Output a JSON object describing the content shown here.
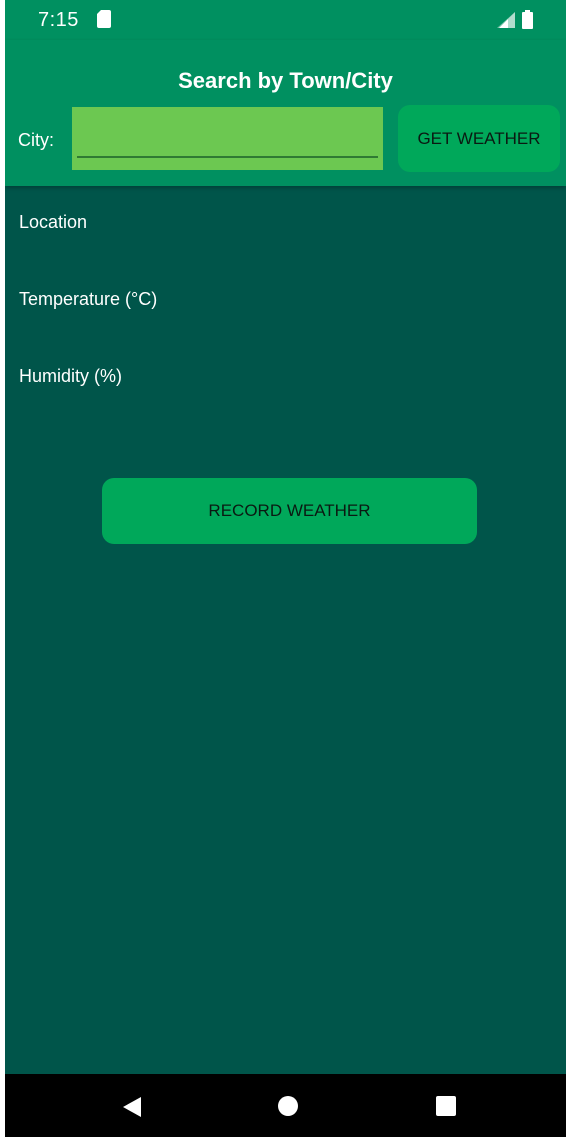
{
  "status_bar": {
    "time": "7:15",
    "icons": [
      "sd-card-icon",
      "signal-icon",
      "battery-icon"
    ]
  },
  "header": {
    "title": "Search by Town/City",
    "city_label": "City:",
    "city_input": {
      "value": "",
      "placeholder": ""
    },
    "get_weather_label": "GET WEATHER"
  },
  "results": {
    "location_label": "Location",
    "temperature_label": "Temperature (°C)",
    "humidity_label": "Humidity (%)"
  },
  "record_weather_label": "RECORD WEATHER",
  "nav_bar": {
    "icons": [
      "back-icon",
      "home-icon",
      "recents-icon"
    ]
  },
  "colors": {
    "header_bg": "#009060",
    "body_bg": "#00554a",
    "input_bg": "#6cc851",
    "button_bg": "#00a85a",
    "nav_bg": "#000000"
  }
}
